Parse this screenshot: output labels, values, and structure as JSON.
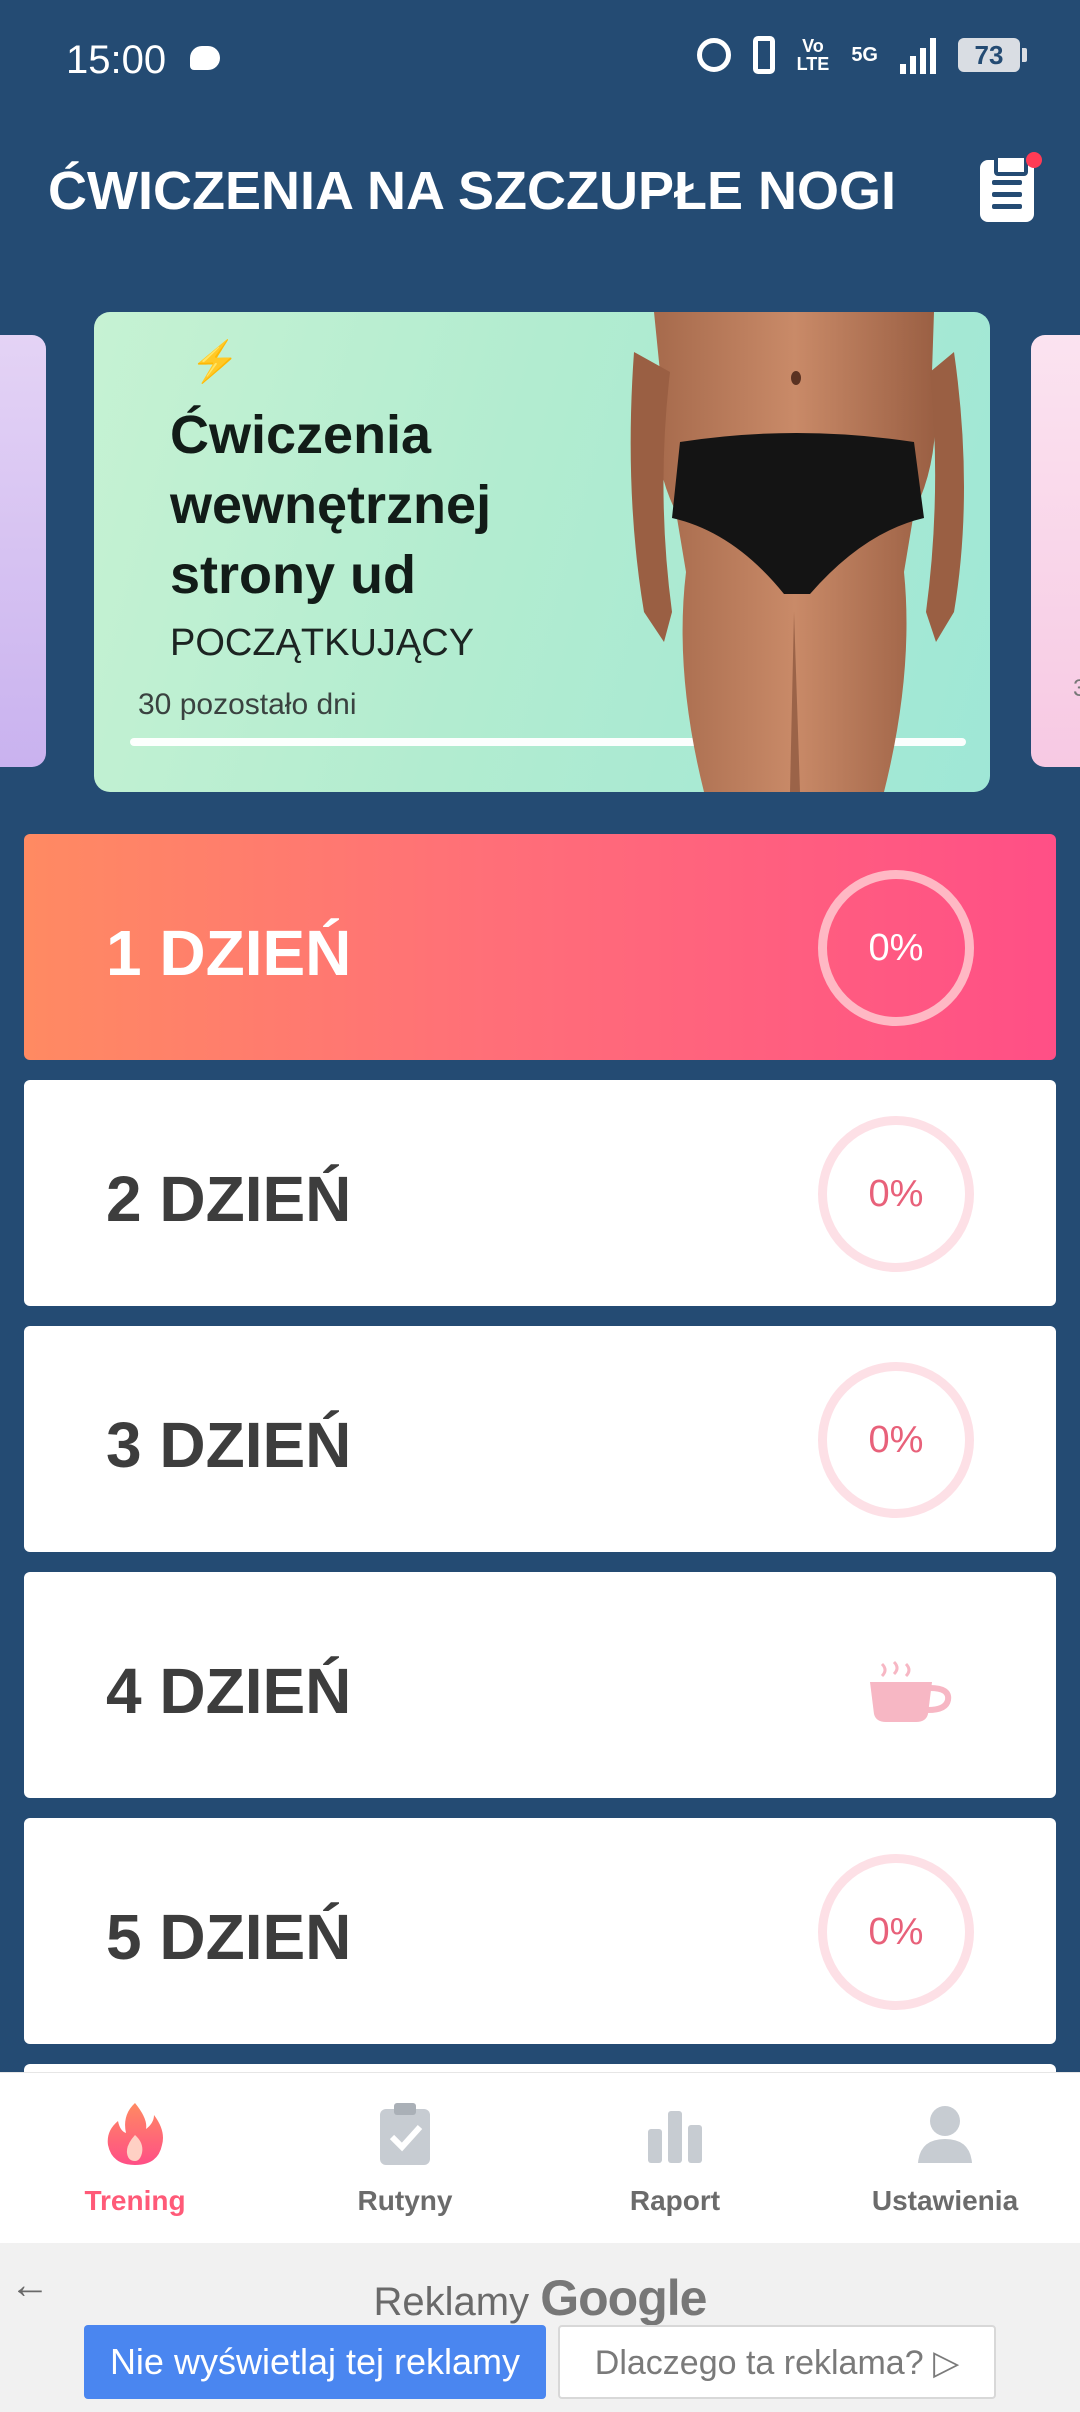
{
  "status_bar": {
    "time": "15:00",
    "network": "5G",
    "volte": "Vo\nLTE",
    "battery": "73"
  },
  "header": {
    "title": "ĆWICZENIA NA SZCZUPŁE NOGI",
    "notes_icon": "clipboard-icon"
  },
  "banner": {
    "title": "Ćwiczenia wewnętrznej strony ud",
    "level": "POCZĄTKUJĄCY",
    "days_left": "30 pozostało dni",
    "progress": 0,
    "right_peek_text": "3"
  },
  "days": [
    {
      "label": "1 DZIEŃ",
      "progress": "0%",
      "type": "progress",
      "active": true
    },
    {
      "label": "2 DZIEŃ",
      "progress": "0%",
      "type": "progress",
      "active": false
    },
    {
      "label": "3 DZIEŃ",
      "progress": "0%",
      "type": "progress",
      "active": false
    },
    {
      "label": "4 DZIEŃ",
      "progress": "",
      "type": "rest",
      "active": false
    },
    {
      "label": "5 DZIEŃ",
      "progress": "0%",
      "type": "progress",
      "active": false
    }
  ],
  "bottom_nav": [
    {
      "label": "Trening",
      "icon": "flame-icon",
      "selected": true
    },
    {
      "label": "Rutyny",
      "icon": "clipboard-check-icon",
      "selected": false
    },
    {
      "label": "Raport",
      "icon": "bar-chart-icon",
      "selected": false
    },
    {
      "label": "Ustawienia",
      "icon": "person-icon",
      "selected": false
    }
  ],
  "ad": {
    "title_prefix": "Reklamy",
    "title_brand": "Google",
    "hide_button": "Nie wyświetlaj tej reklamy",
    "why_button": "Dlaczego ta reklama?"
  },
  "colors": {
    "background": "#244b73",
    "accent": "#ff5a78",
    "active_card_start": "#ff8a62",
    "active_card_end": "#ff4f86"
  }
}
